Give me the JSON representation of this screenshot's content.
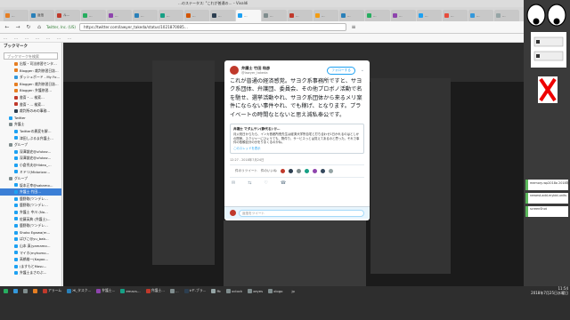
{
  "window": {
    "title": "…のステータス: \"これが普通の… – Vivaldi"
  },
  "tabs": [
    {
      "label": "…",
      "color": "#e67e22",
      "active": false
    },
    {
      "label": "返信",
      "color": "#2980b9",
      "active": false
    },
    {
      "label": "ル…",
      "color": "#c0392b",
      "active": false
    },
    {
      "label": "…",
      "color": "#27ae60",
      "active": false
    },
    {
      "label": "…",
      "color": "#8e44ad",
      "active": false
    },
    {
      "label": "…",
      "color": "#2980b9",
      "active": false
    },
    {
      "label": "…",
      "color": "#16a085",
      "active": false
    },
    {
      "label": "…",
      "color": "#d35400",
      "active": false
    },
    {
      "label": "…",
      "color": "#2c3e50",
      "active": false
    },
    {
      "label": "…",
      "color": "#1da1f2",
      "active": true
    },
    {
      "label": "…",
      "color": "#7f8c8d",
      "active": false
    },
    {
      "label": "…",
      "color": "#c0392b",
      "active": false
    },
    {
      "label": "…",
      "color": "#f39c12",
      "active": false
    },
    {
      "label": "…",
      "color": "#2980b9",
      "active": false
    },
    {
      "label": "…",
      "color": "#27ae60",
      "active": false
    },
    {
      "label": "…",
      "color": "#8e44ad",
      "active": false
    },
    {
      "label": "…",
      "color": "#1da1f2",
      "active": false
    },
    {
      "label": "…",
      "color": "#e74c3c",
      "active": false
    },
    {
      "label": "…",
      "color": "#3498db",
      "active": false
    },
    {
      "label": "…",
      "color": "#95a5a6",
      "active": false
    }
  ],
  "nav": {
    "url": "https://twitter.com/lawyer_takeda/status/1021870085…",
    "site_label": "Twitter, Inc. (US)"
  },
  "bookmarks_bar": [
    "…",
    "…",
    "…",
    "…",
    "…",
    "…",
    "…"
  ],
  "sidebar": {
    "title": "ブックマーク",
    "search_placeholder": "ブックマークを検索",
    "items": [
      {
        "label": "出版・司法修習センタ…",
        "color": "#e67e22",
        "selected": false
      },
      {
        "label": "Blogger: 裁判修習日誌…",
        "color": "#e67e22",
        "selected": false
      },
      {
        "label": "ダッシュボード - My Fo…",
        "color": "#3498db",
        "selected": false
      },
      {
        "label": "Blogger: 裁判修習日誌…",
        "color": "#e67e22",
        "selected": false
      },
      {
        "label": "Blogger: 弁護修習…",
        "color": "#e67e22",
        "selected": false
      },
      {
        "label": "書斎・… 検索…",
        "color": "#c0392b",
        "selected": false
      },
      {
        "label": "書斎・… 検索…",
        "color": "#c0392b",
        "selected": false
      },
      {
        "label": "裁判所のみの事務…",
        "color": "#2c3e50",
        "selected": false
      },
      {
        "label": "Twitter",
        "color": "#1da1f2",
        "selected": false
      },
      {
        "label": "弁護士",
        "color": "#7f8c8d",
        "selected": false
      },
      {
        "label": "Twitterの異変を解…",
        "color": "#1da1f2",
        "selected": false
      },
      {
        "label": "津田しぶるま弁護士…",
        "color": "#1da1f2",
        "selected": false
      },
      {
        "label": "グループ",
        "color": "#7f8c8d",
        "selected": false
      },
      {
        "label": "深澤諭史@ufukaz…",
        "color": "#1da1f2",
        "selected": false
      },
      {
        "label": "深澤諭史@ufukaz…",
        "color": "#1da1f2",
        "selected": false
      },
      {
        "label": "小倉秀夫@Hideo_…",
        "color": "#1da1f2",
        "selected": false
      },
      {
        "label": "ミドリ(Midorizar…",
        "color": "#1da1f2",
        "selected": false
      },
      {
        "label": "グループ",
        "color": "#7f8c8d",
        "selected": false
      },
      {
        "label": "坂本正幸@sakamo…",
        "color": "#1da1f2",
        "selected": false
      },
      {
        "label": "弁護士 竹田…",
        "color": "#1da1f2",
        "selected": true
      },
      {
        "label": "鹿野剛(ツンデレ…",
        "color": "#1da1f2",
        "selected": false
      },
      {
        "label": "鹿野剛(ツンデレ…",
        "color": "#1da1f2",
        "selected": false
      },
      {
        "label": "弁護士 中川 (No…",
        "color": "#1da1f2",
        "selected": false
      },
      {
        "label": "佐藤英典 (弁護士)…",
        "color": "#1da1f2",
        "selected": false
      },
      {
        "label": "鹿野剛(ツンデレ…",
        "color": "#1da1f2",
        "selected": false
      },
      {
        "label": "Shoko Egawa(m…",
        "color": "#1da1f2",
        "selected": false
      },
      {
        "label": "ばびこ@yu_bab…",
        "color": "#1da1f2",
        "selected": false
      },
      {
        "label": "山本 真(yamamo…",
        "color": "#1da1f2",
        "selected": false
      },
      {
        "label": "マイホ(myhomo…",
        "color": "#1da1f2",
        "selected": false
      },
      {
        "label": "高橋雄一(Kagoo…",
        "color": "#1da1f2",
        "selected": false
      },
      {
        "label": "(ますもとMasu…",
        "color": "#1da1f2",
        "selected": false
      },
      {
        "label": "弁護士まさのぶ…",
        "color": "#1da1f2",
        "selected": false
      }
    ]
  },
  "tweet": {
    "author_name": "弁護士 竹田 和彦",
    "author_handle": "@lawyer_takeda",
    "follow_label": "フォローする",
    "text": "これが普通の経済感覚。サヨク系事務所ですと、サヨク系団体、弁護団、委員会、その他プロボノ活動で名を馳せ、選挙活動やれ、サヨク系団体から来るメリ案件にならない事件やれ、でも稼げ、となります。プライベートの時間なとないと思え減私奉公です。",
    "quote_author": "弁護士 マダムサン(静代る) @… ",
    "quote_text": "月火祝日からたら、インカ首都所長先生は経済犬学所自宅と打ち合わせ1日かれるのはとしかの関係。スクジャーにひょうても、物件り、サービスっとは覚えてあるのと思った。それで事件の依頼自分の分をりまくるのかね。",
    "quote_link": "このスレッドを表示",
    "time": "12:27 - 2018年7月24日",
    "stats_label": "件のリツイート　件のいいね",
    "reply_placeholder": "返信をツイート"
  },
  "taskbar": {
    "items": [
      {
        "label": "",
        "color": "#27ae60"
      },
      {
        "label": "",
        "color": "#3498db"
      },
      {
        "label": "",
        "color": "#7f8c8d"
      },
      {
        "label": "",
        "color": "#e67e22"
      },
      {
        "label": "アラーム",
        "color": "#c0392b"
      },
      {
        "label": "Ж_タスク…",
        "color": "#2980b9"
      },
      {
        "label": "弁護士…",
        "color": "#8e44ad"
      },
      {
        "label": "emacs…",
        "color": "#16a085"
      },
      {
        "label": "弁護士…",
        "color": "#c0392b"
      },
      {
        "label": "…",
        "color": "#7f8c8d"
      },
      {
        "label": "kヤ-ブラ…",
        "color": "#2c3e50"
      },
      {
        "label": "ffc",
        "color": "#95a5a6"
      },
      {
        "label": "xclock",
        "color": "#7f8c8d"
      },
      {
        "label": "xeyes",
        "color": "#7f8c8d"
      },
      {
        "label": "xlogo",
        "color": "#7f8c8d"
      }
    ],
    "lang": "jp",
    "time": "11:54",
    "date": "2018年7月25日水曜日"
  },
  "sticky_notes": [
    "memory-wp2018a 2018年7",
    "newest-add-mybid-units",
    "screenShot"
  ],
  "colors": {
    "accent": "#1da1f2",
    "selection": "#3b7fd6",
    "avatar": "#c0392b"
  }
}
